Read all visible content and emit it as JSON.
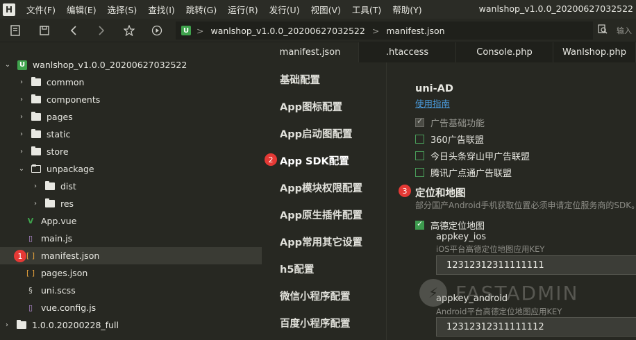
{
  "menubar": {
    "logo": "H",
    "items": [
      "文件(F)",
      "编辑(E)",
      "选择(S)",
      "查找(I)",
      "跳转(G)",
      "运行(R)",
      "发行(U)",
      "视图(V)",
      "工具(T)",
      "帮助(Y)"
    ],
    "window_title": "wanlshop_v1.0.0_20200627032522"
  },
  "toolbar": {
    "address_project": "wanlshop_v1.0.0_20200627032522",
    "address_sep": ">",
    "address_file": "manifest.json",
    "search_hint": "输入"
  },
  "sidebar": {
    "project": "wanlshop_v1.0.0_20200627032522",
    "items": [
      {
        "label": "common"
      },
      {
        "label": "components"
      },
      {
        "label": "pages"
      },
      {
        "label": "static"
      },
      {
        "label": "store"
      },
      {
        "label": "unpackage"
      },
      {
        "label": "dist"
      },
      {
        "label": "res"
      },
      {
        "label": "App.vue"
      },
      {
        "label": "main.js"
      },
      {
        "label": "manifest.json"
      },
      {
        "label": "pages.json"
      },
      {
        "label": "uni.scss"
      },
      {
        "label": "vue.config.js"
      },
      {
        "label": "1.0.0.20200228_full"
      }
    ],
    "marker_1": "1"
  },
  "tabs": [
    "manifest.json",
    ".htaccess",
    "Console.php",
    "Wanlshop.php"
  ],
  "config_nav": {
    "items": [
      "基础配置",
      "App图标配置",
      "App启动图配置",
      "App SDK配置",
      "App模块权限配置",
      "App原生插件配置",
      "App常用其它设置",
      "h5配置",
      "微信小程序配置",
      "百度小程序配置"
    ],
    "marker_2": "2"
  },
  "content": {
    "ad_title": "uni-AD",
    "ad_link": "使用指南",
    "ad_options": [
      {
        "label": "广告基础功能",
        "state": "disabled-checked"
      },
      {
        "label": "360广告联盟",
        "state": "unchecked"
      },
      {
        "label": "今日头条穿山甲广告联盟",
        "state": "unchecked"
      },
      {
        "label": "腾讯广点通广告联盟",
        "state": "unchecked"
      }
    ],
    "marker_3": "3",
    "map_title": "定位和地图",
    "map_desc": "部分国产Android手机获取位置必须申请定位服务商的SDK。",
    "amap_label": "高德定位地图",
    "ios_key_label": "appkey_ios",
    "ios_key_hint": "iOS平台高德定位地图应用KEY",
    "ios_key_value": "12312312311111111",
    "android_key_label": "appkey_android",
    "android_key_hint": "Android平台高德定位地图应用KEY",
    "android_key_value": "12312312311111112"
  },
  "watermark": {
    "text": "FASTADMIN"
  },
  "colors": {
    "accent_green": "#3d9b4e",
    "marker_red": "#e53935",
    "link_blue": "#4a9bdd"
  }
}
